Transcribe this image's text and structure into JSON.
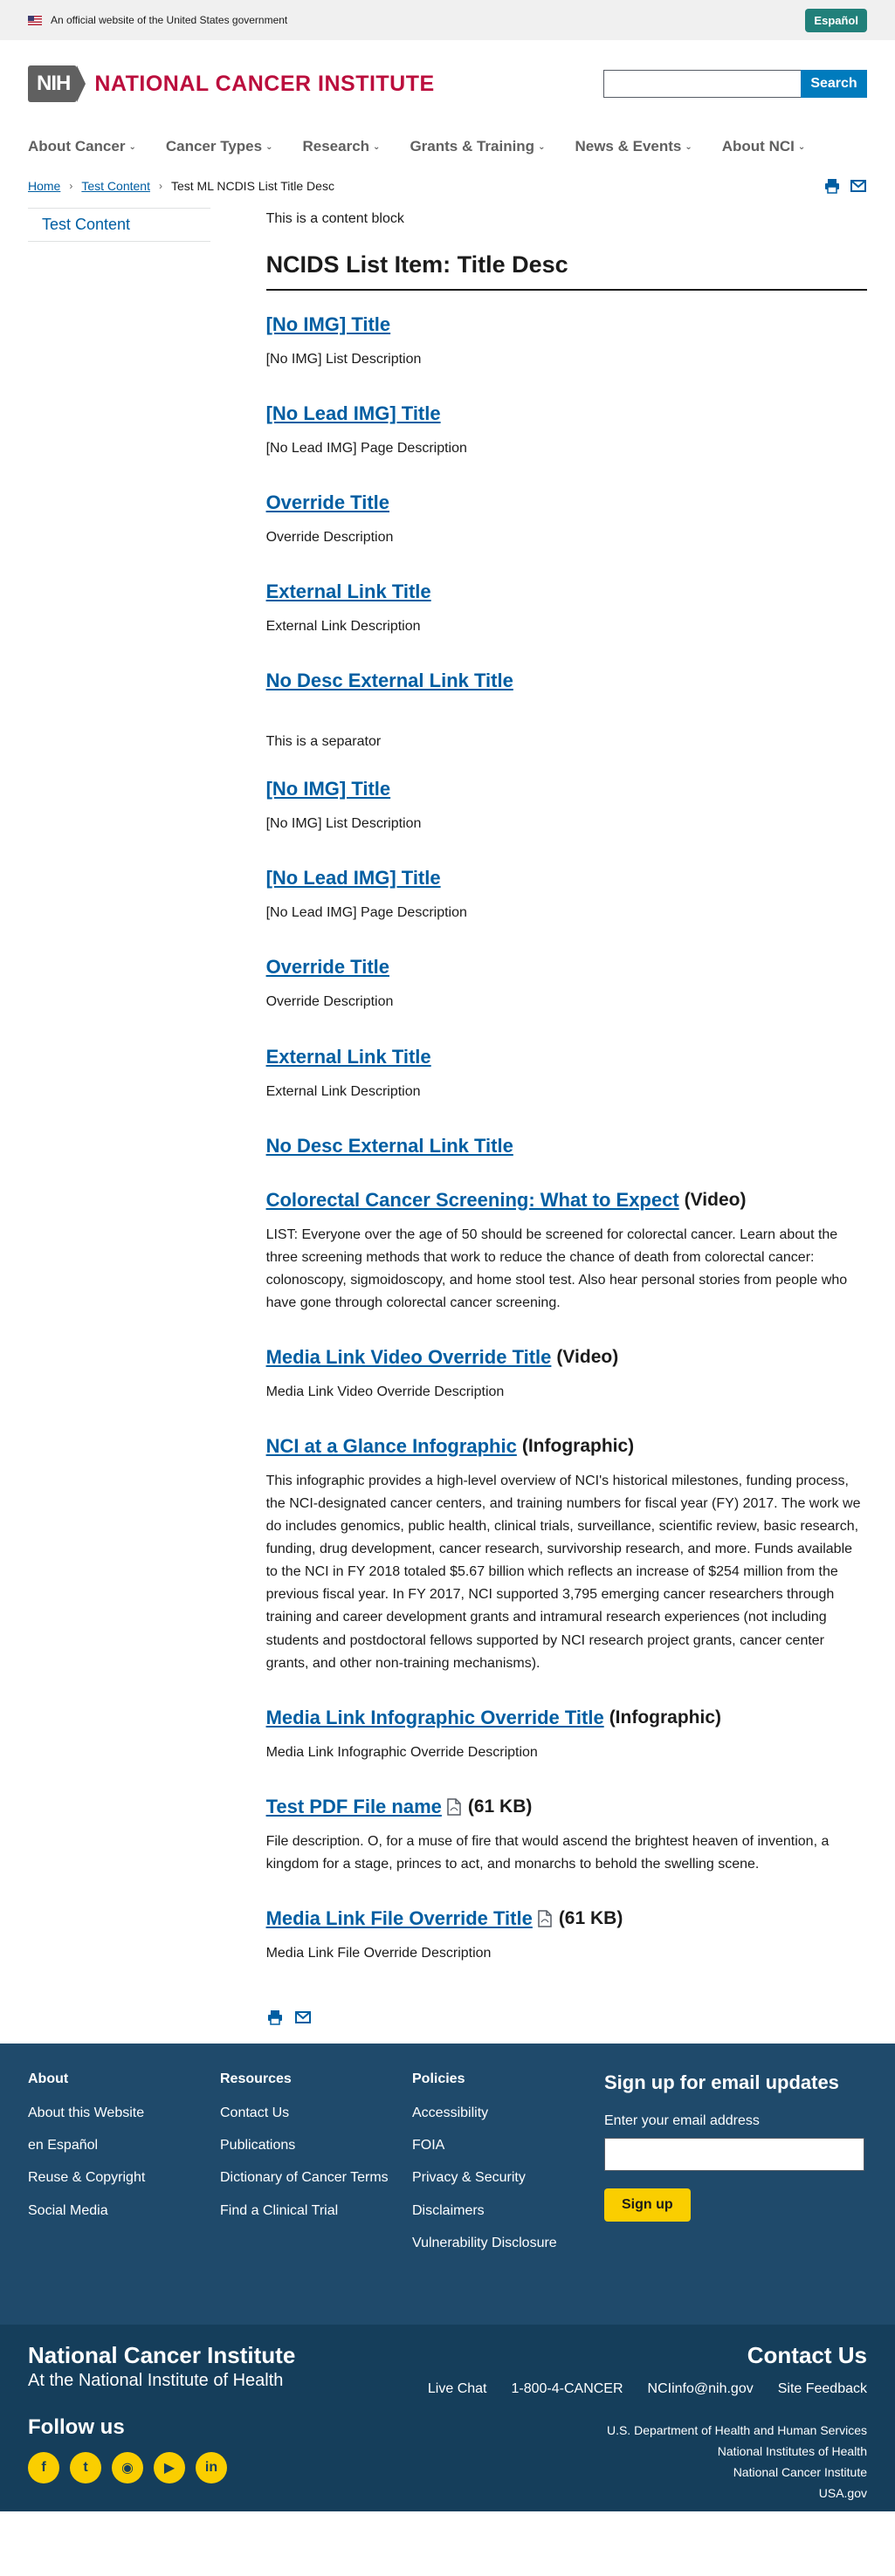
{
  "gov_banner": {
    "text": "An official website of the United States government",
    "espanol": "Español"
  },
  "header": {
    "logo_nih": "NIH",
    "logo_text": "NATIONAL CANCER INSTITUTE",
    "search_button": "Search",
    "search_placeholder": ""
  },
  "nav": [
    "About Cancer",
    "Cancer Types",
    "Research",
    "Grants & Training",
    "News & Events",
    "About NCI"
  ],
  "breadcrumb": {
    "home": "Home",
    "test_content": "Test Content",
    "current": "Test ML NCDIS List Title Desc"
  },
  "sidebar": {
    "link": "Test Content"
  },
  "content_block": "This is a content block",
  "list_title": "NCIDS List Item: Title Desc",
  "group1": [
    {
      "title": "[No IMG] Title",
      "desc": "[No IMG] List Description"
    },
    {
      "title": "[No Lead IMG] Title",
      "desc": "[No Lead IMG] Page Description"
    },
    {
      "title": "Override Title",
      "desc": "Override Description"
    },
    {
      "title": "External Link Title",
      "desc": "External Link Description"
    },
    {
      "title": "No Desc External Link Title",
      "desc": ""
    }
  ],
  "separator": "This is a separator",
  "group2": [
    {
      "title": "[No IMG] Title",
      "desc": "[No IMG] List Description"
    },
    {
      "title": "[No Lead IMG] Title",
      "desc": "[No Lead IMG] Page Description"
    },
    {
      "title": "Override Title",
      "desc": "Override Description"
    },
    {
      "title": "External Link Title",
      "desc": "External Link Description"
    },
    {
      "title": "No Desc External Link Title",
      "desc": ""
    }
  ],
  "media": {
    "video1": {
      "title": "Colorectal Cancer Screening: What to Expect",
      "type": "(Video)",
      "desc": "LIST: Everyone over the age of 50 should be screened for colorectal cancer. Learn about the three screening methods that work to reduce the chance of death from colorectal cancer: colonoscopy, sigmoidoscopy, and home stool test. Also hear personal stories from people who have gone through colorectal cancer screening."
    },
    "video2": {
      "title": "Media Link Video Override Title",
      "type": "(Video)",
      "desc": "Media Link Video Override Description"
    },
    "info1": {
      "title": "NCI at a Glance Infographic",
      "type": "(Infographic)",
      "desc": "This infographic provides a high-level overview of NCI's historical milestones, funding process, the NCI-designated cancer centers, and training numbers for fiscal year (FY) 2017. The work we do includes genomics, public health, clinical trials, surveillance, scientific review, basic research, funding, drug development, cancer research, survivorship research, and more. Funds available to the NCI in FY 2018 totaled $5.67 billion which reflects an increase of $254 million from the previous fiscal year. In FY 2017, NCI supported 3,795 emerging cancer researchers through training and career development grants and intramural research experiences (not including students and postdoctoral fellows supported by NCI research project grants, cancer center grants, and other non-training mechanisms)."
    },
    "info2": {
      "title": "Media Link Infographic Override Title",
      "type": "(Infographic)",
      "desc": "Media Link Infographic Override Description"
    },
    "file1": {
      "title": "Test PDF File name",
      "size": "(61 KB)",
      "desc": "File description. O, for a muse of fire that would ascend the brightest heaven of invention, a kingdom for a stage, princes to act, and monarchs to behold the swelling scene."
    },
    "file2": {
      "title": "Media Link File Override Title",
      "size": "(61 KB)",
      "desc": "Media Link File Override Description"
    }
  },
  "footer": {
    "about": {
      "heading": "About",
      "links": [
        "About this Website",
        "en Español",
        "Reuse & Copyright",
        "Social Media"
      ]
    },
    "resources": {
      "heading": "Resources",
      "links": [
        "Contact Us",
        "Publications",
        "Dictionary of Cancer Terms",
        "Find a Clinical Trial"
      ]
    },
    "policies": {
      "heading": "Policies",
      "links": [
        "Accessibility",
        "FOIA",
        "Privacy & Security",
        "Disclaimers",
        "Vulnerability Disclosure"
      ]
    },
    "signup": {
      "heading": "Sign up for email updates",
      "label": "Enter your email address",
      "button": "Sign up"
    },
    "org": {
      "name": "National Cancer Institute",
      "sub": "At the National Institute of Health"
    },
    "follow": "Follow us",
    "contact": {
      "heading": "Contact Us",
      "links": [
        "Live Chat",
        "1-800-4-CANCER",
        "NCIinfo@nih.gov",
        "Site Feedback"
      ]
    },
    "agencies": [
      "U.S. Department of Health and Human Services",
      "National Institutes of Health",
      "National Cancer Institute",
      "USA.gov"
    ],
    "social": [
      "facebook-icon",
      "twitter-icon",
      "instagram-icon",
      "youtube-icon",
      "linkedin-icon"
    ]
  }
}
